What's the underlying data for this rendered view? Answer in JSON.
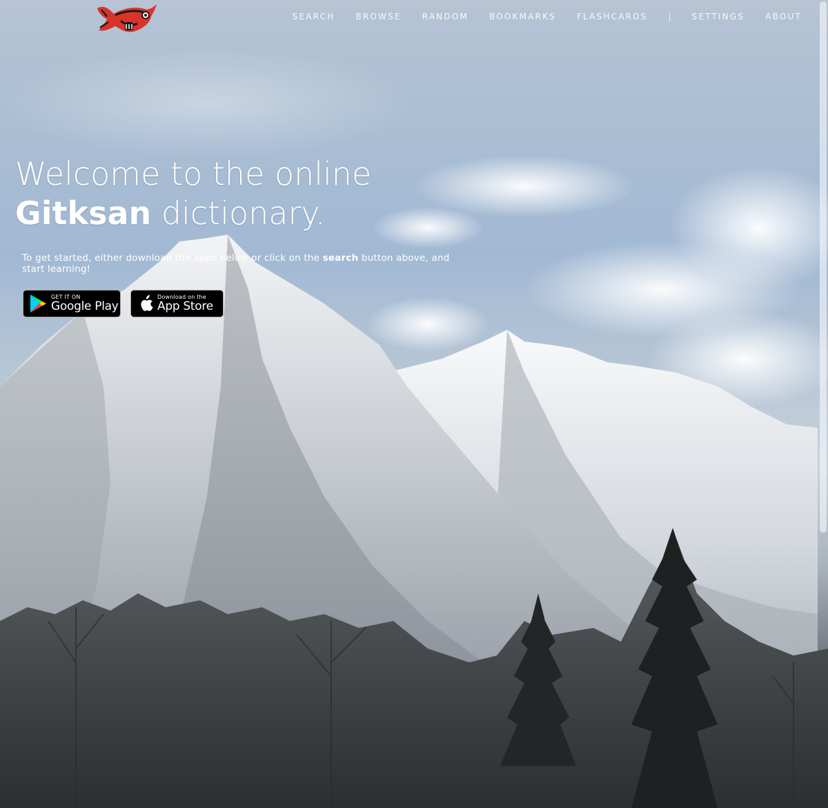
{
  "nav": {
    "items": [
      {
        "label": "SEARCH"
      },
      {
        "label": "BROWSE"
      },
      {
        "label": "RANDOM"
      },
      {
        "label": "BOOKMARKS"
      },
      {
        "label": "FLASHCARDS"
      }
    ],
    "separator": "|",
    "items_right": [
      {
        "label": "SETTINGS"
      },
      {
        "label": "ABOUT"
      }
    ]
  },
  "logo": {
    "icon": "gitksan-fish-logo"
  },
  "hero": {
    "title_line1": "Welcome to the online",
    "title_bold": "Gitksan",
    "title_rest": " dictionary.",
    "intro_before": "To get started, either download the apps below or click on the ",
    "intro_bold": "search",
    "intro_after": " button above, and start learning!"
  },
  "badges": {
    "google": {
      "small": "GET IT ON",
      "big": "Google Play",
      "icon": "google-play-icon"
    },
    "apple": {
      "small": "Download on the",
      "big": "App Store",
      "icon": "apple-icon"
    }
  },
  "colors": {
    "nav_text": "#ffffff",
    "badge_bg": "#000000",
    "logo_red": "#d9342b"
  }
}
